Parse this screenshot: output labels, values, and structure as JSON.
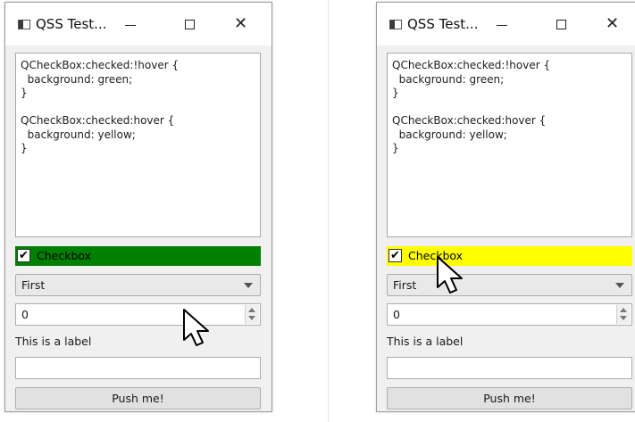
{
  "windows": [
    {
      "title": "QSS Test...",
      "stylesheet_lines": [
        "QCheckBox:checked:!hover {",
        "  background: green;",
        "}",
        "",
        "QCheckBox:checked:hover {",
        "  background: yellow;",
        "}"
      ],
      "checkbox": {
        "label": "Checkbox",
        "checked": true,
        "background": "#008000",
        "text_color": "#000000"
      },
      "combo": {
        "selected": "First"
      },
      "spinbox": {
        "value": "0"
      },
      "label_text": "This is a label",
      "line_edit": {
        "value": ""
      },
      "push_button": "Push me!"
    },
    {
      "title": "QSS Test...",
      "stylesheet_lines": [
        "QCheckBox:checked:!hover {",
        "  background: green;",
        "}",
        "",
        "QCheckBox:checked:hover {",
        "  background: yellow;",
        "}"
      ],
      "checkbox": {
        "label": "Checkbox",
        "checked": true,
        "background": "#ffff00",
        "text_color": "#000000"
      },
      "combo": {
        "selected": "First"
      },
      "spinbox": {
        "value": "0"
      },
      "label_text": "This is a label",
      "line_edit": {
        "value": ""
      },
      "push_button": "Push me!"
    }
  ],
  "icons": {
    "app": "qt-window-icon",
    "minimize": "minimize-icon",
    "maximize": "maximize-icon",
    "close": "close-icon",
    "cursor": "mouse-pointer-icon"
  }
}
